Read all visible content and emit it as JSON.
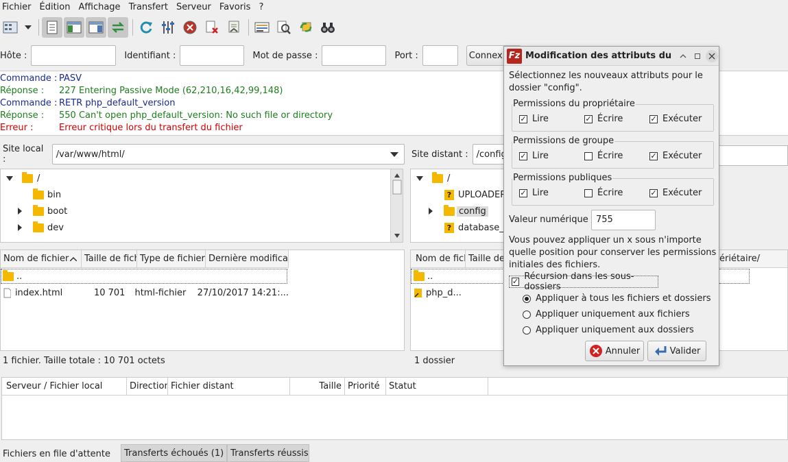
{
  "menu": [
    "Fichier",
    "Édition",
    "Affichage",
    "Transfert",
    "Serveur",
    "Favoris",
    "?"
  ],
  "toolbar": {
    "icons": [
      "site-manager-icon",
      "dropdown-arrow-icon",
      "toggle-log-icon",
      "toggle-local-tree-icon",
      "toggle-remote-tree-icon",
      "toggle-queue-icon",
      "refresh-icon",
      "process-queue-icon",
      "cancel-icon",
      "disconnect-icon",
      "reconnect-icon",
      "filter-icon",
      "compare-icon",
      "sync-browse-icon",
      "find-icon"
    ]
  },
  "quickconnect": {
    "host_label": "Hôte :",
    "user_label": "Identifiant :",
    "pass_label": "Mot de passe :",
    "port_label": "Port :",
    "connect_button": "Connexion rapide",
    "host_value": "",
    "user_value": "",
    "pass_value": "",
    "port_value": ""
  },
  "log": [
    {
      "type": "Commande :",
      "text": "PASV",
      "kind": "cmd"
    },
    {
      "type": "Réponse :",
      "text": "227 Entering Passive Mode (62,210,16,42,99,148)",
      "kind": "resp"
    },
    {
      "type": "Commande :",
      "text": "RETR php_default_version",
      "kind": "cmd"
    },
    {
      "type": "Réponse :",
      "text": "550 Can't open php_default_version: No such file or directory",
      "kind": "resp"
    },
    {
      "type": "Erreur :",
      "text": "Erreur critique lors du transfert du fichier",
      "kind": "err"
    }
  ],
  "local": {
    "site_label": "Site local :",
    "path": "/var/www/html/",
    "tree": [
      "/",
      "bin",
      "boot",
      "dev"
    ],
    "columns": [
      "Nom de fichier",
      "Taille de fichi",
      "Type de fichier",
      "Dernière modificati"
    ],
    "rows": [
      {
        "name": "..",
        "size": "",
        "type": "",
        "modified": ""
      },
      {
        "name": "index.html",
        "size": "10 701",
        "type": "html-fichier",
        "modified": "27/10/2017 14:21:..."
      }
    ],
    "status": "1 fichier. Taille totale : 10 701 octets"
  },
  "remote": {
    "site_label": "Site distant :",
    "path": "/config",
    "tree": [
      "/",
      "UPLOADER",
      "config",
      "database_b"
    ],
    "columns": [
      "Nom de fich",
      "Taille de",
      "ériétaire/"
    ],
    "rows": [
      {
        "name": ".."
      },
      {
        "name": "php_d..."
      }
    ],
    "status": "1 dossier"
  },
  "queue": {
    "columns": [
      "Serveur / Fichier local",
      "Direction",
      "Fichier distant",
      "Taille",
      "Priorité",
      "Statut"
    ],
    "tabs": [
      "Fichiers en file d'attente",
      "Transferts échoués (1)",
      "Transferts réussis"
    ]
  },
  "dialog": {
    "title": "Modification des attributs du fi",
    "intro": "Sélectionnez les nouveaux attributs pour le dossier \"config\".",
    "groups": [
      {
        "title": "Permissions du propriétaire",
        "items": [
          {
            "label": "Lire",
            "checked": true
          },
          {
            "label": "Écrire",
            "checked": true
          },
          {
            "label": "Exécuter",
            "checked": true
          }
        ]
      },
      {
        "title": "Permissions de groupe",
        "items": [
          {
            "label": "Lire",
            "checked": true
          },
          {
            "label": "Écrire",
            "checked": false
          },
          {
            "label": "Exécuter",
            "checked": true
          }
        ]
      },
      {
        "title": "Permissions publiques",
        "items": [
          {
            "label": "Lire",
            "checked": true
          },
          {
            "label": "Écrire",
            "checked": false
          },
          {
            "label": "Exécuter",
            "checked": true
          }
        ]
      }
    ],
    "numeric_label": "Valeur numérique :",
    "numeric_value": "755",
    "hint": "Vous pouvez appliquer un x sous n'importe quelle position pour conserver les permissions initiales des fichiers.",
    "recursion_label": "Récursion dans les sous-dossiers",
    "recursion_checked": true,
    "radios": [
      {
        "label": "Appliquer à tous les fichiers et dossiers",
        "selected": true
      },
      {
        "label": "Appliquer uniquement aux fichiers",
        "selected": false
      },
      {
        "label": "Appliquer uniquement aux dossiers",
        "selected": false
      }
    ],
    "cancel_label": "Annuler",
    "ok_label": "Valider"
  },
  "colors": {
    "command": "#1a2a8c",
    "response": "#1e7e1e",
    "error": "#d00000",
    "folder": "#f5b800",
    "filezilla": "#b7261d"
  }
}
